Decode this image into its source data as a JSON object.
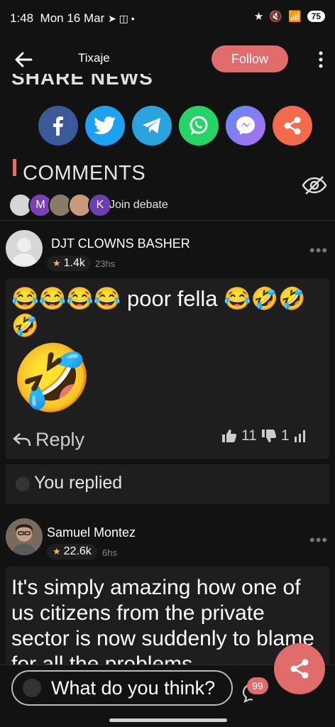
{
  "status_bar": {
    "time": "1:48",
    "date": "Mon 16 Mar",
    "battery": "75"
  },
  "header": {
    "title": "Tixaje",
    "follow_label": "Follow"
  },
  "share": {
    "heading": "SHARE NEWS",
    "buttons": [
      {
        "name": "facebook",
        "color": "#3b5998"
      },
      {
        "name": "twitter",
        "color": "#1da1f2"
      },
      {
        "name": "telegram",
        "color": "#2aa3df"
      },
      {
        "name": "whatsapp",
        "color": "#25d366"
      },
      {
        "name": "messenger",
        "color": "#8e6cf0"
      },
      {
        "name": "share",
        "color": "#f26b4d"
      }
    ]
  },
  "comments": {
    "heading": "COMMENTS",
    "join_label": "Join debate",
    "avatar_letters": [
      "",
      "M",
      "",
      "",
      "K"
    ]
  },
  "comment1": {
    "user": "DJT CLOWNS BASHER",
    "karma": "1.4k",
    "time": "23hs",
    "text": "😂😂😂😂 poor fella 😂🤣🤣🤣",
    "emoji": "🤣",
    "reply_label": "Reply",
    "upvotes": "11",
    "downvotes": "1",
    "you_replied": "You replied"
  },
  "comment2": {
    "user": "Samuel Montez",
    "karma": "22.6k",
    "time": "6hs",
    "text": "It's simply amazing how one of us citizens from the private sector is now suddenly to blame for all the problems"
  },
  "composer": {
    "placeholder": "What do you think?",
    "count": "99"
  },
  "colors": {
    "accent": "#e06c6c",
    "background": "#121212",
    "card": "#1e1e1e"
  }
}
